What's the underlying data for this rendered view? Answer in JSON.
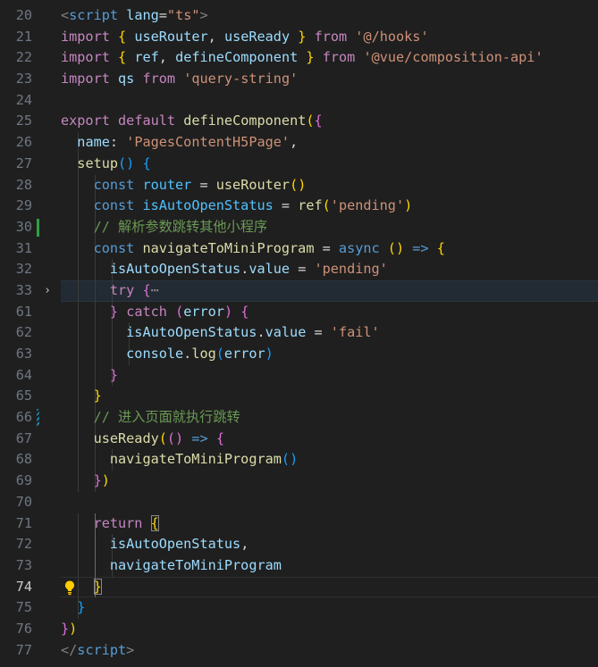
{
  "editor": {
    "lines": [
      {
        "n": "20",
        "indent": 0,
        "tokens": [
          [
            "tag",
            "<"
          ],
          [
            "tagn",
            "script"
          ],
          [
            "pl",
            " "
          ],
          [
            "attr",
            "lang"
          ],
          [
            "pl",
            "="
          ],
          [
            "str",
            "\"ts\""
          ],
          [
            "tag",
            ">"
          ]
        ]
      },
      {
        "n": "21",
        "indent": 0,
        "tokens": [
          [
            "ctl",
            "import"
          ],
          [
            "pl",
            " "
          ],
          [
            "b1",
            "{"
          ],
          [
            "pl",
            " "
          ],
          [
            "var",
            "useRouter"
          ],
          [
            "pl",
            ", "
          ],
          [
            "var",
            "useReady"
          ],
          [
            "pl",
            " "
          ],
          [
            "b1",
            "}"
          ],
          [
            "pl",
            " "
          ],
          [
            "ctl",
            "from"
          ],
          [
            "pl",
            " "
          ],
          [
            "str",
            "'@/hooks'"
          ]
        ]
      },
      {
        "n": "22",
        "indent": 0,
        "tokens": [
          [
            "ctl",
            "import"
          ],
          [
            "pl",
            " "
          ],
          [
            "b1",
            "{"
          ],
          [
            "pl",
            " "
          ],
          [
            "var",
            "ref"
          ],
          [
            "pl",
            ", "
          ],
          [
            "var",
            "defineComponent"
          ],
          [
            "pl",
            " "
          ],
          [
            "b1",
            "}"
          ],
          [
            "pl",
            " "
          ],
          [
            "ctl",
            "from"
          ],
          [
            "pl",
            " "
          ],
          [
            "str",
            "'@vue/composition-api'"
          ]
        ]
      },
      {
        "n": "23",
        "indent": 0,
        "tokens": [
          [
            "ctl",
            "import"
          ],
          [
            "pl",
            " "
          ],
          [
            "var",
            "qs"
          ],
          [
            "pl",
            " "
          ],
          [
            "ctl",
            "from"
          ],
          [
            "pl",
            " "
          ],
          [
            "str",
            "'query-string'"
          ]
        ]
      },
      {
        "n": "24",
        "indent": 0,
        "tokens": []
      },
      {
        "n": "25",
        "indent": 0,
        "tokens": [
          [
            "ctl",
            "export"
          ],
          [
            "pl",
            " "
          ],
          [
            "ctl",
            "default"
          ],
          [
            "pl",
            " "
          ],
          [
            "fn",
            "defineComponent"
          ],
          [
            "b1",
            "("
          ],
          [
            "b2",
            "{"
          ]
        ]
      },
      {
        "n": "26",
        "indent": 1,
        "tokens": [
          [
            "pl",
            "  "
          ],
          [
            "var",
            "name"
          ],
          [
            "pl",
            ": "
          ],
          [
            "str",
            "'PagesContentH5Page'"
          ],
          [
            "pl",
            ","
          ]
        ]
      },
      {
        "n": "27",
        "indent": 1,
        "tokens": [
          [
            "pl",
            "  "
          ],
          [
            "fn",
            "setup"
          ],
          [
            "b3",
            "("
          ],
          [
            "b3",
            ")"
          ],
          [
            "pl",
            " "
          ],
          [
            "b3",
            "{"
          ]
        ]
      },
      {
        "n": "28",
        "indent": 2,
        "tokens": [
          [
            "pl",
            "    "
          ],
          [
            "kw",
            "const"
          ],
          [
            "pl",
            " "
          ],
          [
            "cst",
            "router"
          ],
          [
            "pl",
            " = "
          ],
          [
            "fn",
            "useRouter"
          ],
          [
            "b1",
            "("
          ],
          [
            "b1",
            ")"
          ]
        ]
      },
      {
        "n": "29",
        "indent": 2,
        "tokens": [
          [
            "pl",
            "    "
          ],
          [
            "kw",
            "const"
          ],
          [
            "pl",
            " "
          ],
          [
            "cst",
            "isAutoOpenStatus"
          ],
          [
            "pl",
            " = "
          ],
          [
            "fn",
            "ref"
          ],
          [
            "b1",
            "("
          ],
          [
            "str",
            "'pending'"
          ],
          [
            "b1",
            ")"
          ]
        ]
      },
      {
        "n": "30",
        "indent": 2,
        "gutter": "added",
        "tokens": [
          [
            "pl",
            "    "
          ],
          [
            "cm",
            "// 解析参数跳转其他小程序"
          ]
        ]
      },
      {
        "n": "31",
        "indent": 2,
        "tokens": [
          [
            "pl",
            "    "
          ],
          [
            "kw",
            "const"
          ],
          [
            "pl",
            " "
          ],
          [
            "fn",
            "navigateToMiniProgram"
          ],
          [
            "pl",
            " = "
          ],
          [
            "kw",
            "async"
          ],
          [
            "pl",
            " "
          ],
          [
            "b1",
            "("
          ],
          [
            "b1",
            ")"
          ],
          [
            "pl",
            " "
          ],
          [
            "kw",
            "=>"
          ],
          [
            "pl",
            " "
          ],
          [
            "b1",
            "{"
          ]
        ]
      },
      {
        "n": "32",
        "indent": 3,
        "tokens": [
          [
            "pl",
            "      "
          ],
          [
            "var",
            "isAutoOpenStatus"
          ],
          [
            "pl",
            "."
          ],
          [
            "var",
            "value"
          ],
          [
            "pl",
            " = "
          ],
          [
            "str",
            "'pending'"
          ]
        ]
      },
      {
        "n": "33",
        "indent": 3,
        "fold": "›",
        "highlight": true,
        "tokens": [
          [
            "pl",
            "      "
          ],
          [
            "ctl",
            "try"
          ],
          [
            "pl",
            " "
          ],
          [
            "b2",
            "{"
          ],
          [
            "fold-ellipsis",
            "⋯"
          ]
        ]
      },
      {
        "n": "61",
        "indent": 3,
        "tokens": [
          [
            "pl",
            "      "
          ],
          [
            "b2",
            "}"
          ],
          [
            "pl",
            " "
          ],
          [
            "ctl",
            "catch"
          ],
          [
            "pl",
            " "
          ],
          [
            "b2",
            "("
          ],
          [
            "var",
            "error"
          ],
          [
            "b2",
            ")"
          ],
          [
            "pl",
            " "
          ],
          [
            "b2",
            "{"
          ]
        ]
      },
      {
        "n": "62",
        "indent": 4,
        "tokens": [
          [
            "pl",
            "        "
          ],
          [
            "var",
            "isAutoOpenStatus"
          ],
          [
            "pl",
            "."
          ],
          [
            "var",
            "value"
          ],
          [
            "pl",
            " = "
          ],
          [
            "str",
            "'fail'"
          ]
        ]
      },
      {
        "n": "63",
        "indent": 4,
        "tokens": [
          [
            "pl",
            "        "
          ],
          [
            "var",
            "console"
          ],
          [
            "pl",
            "."
          ],
          [
            "fn",
            "log"
          ],
          [
            "b3",
            "("
          ],
          [
            "var",
            "error"
          ],
          [
            "b3",
            ")"
          ]
        ]
      },
      {
        "n": "64",
        "indent": 3,
        "tokens": [
          [
            "pl",
            "      "
          ],
          [
            "b2",
            "}"
          ]
        ]
      },
      {
        "n": "65",
        "indent": 2,
        "tokens": [
          [
            "pl",
            "    "
          ],
          [
            "b1",
            "}"
          ]
        ]
      },
      {
        "n": "66",
        "indent": 2,
        "gutter": "modified",
        "tokens": [
          [
            "pl",
            "    "
          ],
          [
            "cm",
            "// 进入页面就执行跳转"
          ]
        ]
      },
      {
        "n": "67",
        "indent": 2,
        "tokens": [
          [
            "pl",
            "    "
          ],
          [
            "fn",
            "useReady"
          ],
          [
            "b1",
            "("
          ],
          [
            "b2",
            "("
          ],
          [
            "b2",
            ")"
          ],
          [
            "pl",
            " "
          ],
          [
            "kw",
            "=>"
          ],
          [
            "pl",
            " "
          ],
          [
            "b2",
            "{"
          ]
        ]
      },
      {
        "n": "68",
        "indent": 3,
        "tokens": [
          [
            "pl",
            "      "
          ],
          [
            "fn",
            "navigateToMiniProgram"
          ],
          [
            "b3",
            "("
          ],
          [
            "b3",
            ")"
          ]
        ]
      },
      {
        "n": "69",
        "indent": 2,
        "tokens": [
          [
            "pl",
            "    "
          ],
          [
            "b2",
            "}"
          ],
          [
            "b1",
            ")"
          ]
        ]
      },
      {
        "n": "70",
        "indent": 0,
        "tokens": []
      },
      {
        "n": "71",
        "indent": 2,
        "tokens": [
          [
            "pl",
            "    "
          ],
          [
            "ctl",
            "return"
          ],
          [
            "pl",
            " "
          ],
          [
            "b1m",
            "{"
          ]
        ]
      },
      {
        "n": "72",
        "indent": 3,
        "tokens": [
          [
            "pl",
            "      "
          ],
          [
            "var",
            "isAutoOpenStatus"
          ],
          [
            "pl",
            ","
          ]
        ]
      },
      {
        "n": "73",
        "indent": 3,
        "tokens": [
          [
            "pl",
            "      "
          ],
          [
            "var",
            "navigateToMiniProgram"
          ]
        ]
      },
      {
        "n": "74",
        "indent": 2,
        "active": true,
        "bulb": true,
        "tokens": [
          [
            "pl",
            "    "
          ],
          [
            "b1m",
            "}"
          ]
        ]
      },
      {
        "n": "75",
        "indent": 1,
        "tokens": [
          [
            "pl",
            "  "
          ],
          [
            "b3",
            "}"
          ]
        ]
      },
      {
        "n": "76",
        "indent": 0,
        "tokens": [
          [
            "b2",
            "}"
          ],
          [
            "b1",
            ")"
          ]
        ]
      },
      {
        "n": "77",
        "indent": 0,
        "tokens": [
          [
            "tag",
            "</"
          ],
          [
            "tagn",
            "script"
          ],
          [
            "tag",
            ">"
          ]
        ]
      }
    ]
  },
  "icons": {
    "fold": "chevron-right-icon",
    "bulb": "lightbulb-icon"
  },
  "colors": {
    "background": "#1f1f1f",
    "added": "#2ea043",
    "modified": "#1b81a8",
    "bulb": "#ffcc00"
  }
}
